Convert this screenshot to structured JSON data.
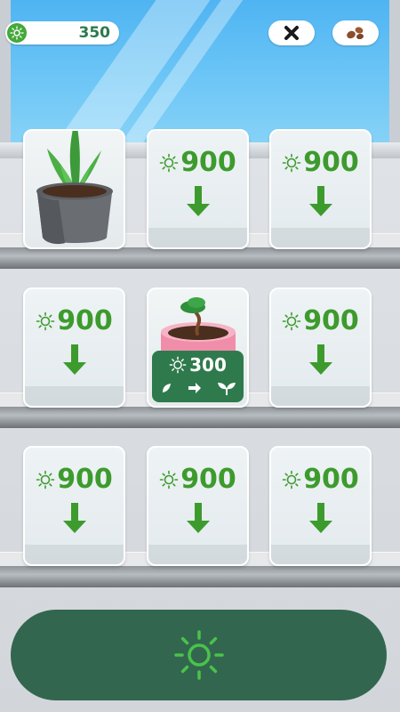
{
  "hud": {
    "sun_count": "350",
    "close_icon": "close-icon",
    "seeds_icon": "seeds-icon"
  },
  "colors": {
    "price_green": "#3d9b2d",
    "panel_green": "#2f7a4d",
    "button_green": "#33664f",
    "sky_blue": "#5dbdf4"
  },
  "shelves": {
    "row1": [
      {
        "state": "owned",
        "plant": "snake-plant-in-gray-pot"
      },
      {
        "state": "locked",
        "price": "900"
      },
      {
        "state": "locked",
        "price": "900"
      }
    ],
    "row2": [
      {
        "state": "locked",
        "price": "900"
      },
      {
        "state": "growing",
        "plant": "bonsai-sprout-in-pink-pot",
        "upgrade_cost": "300"
      },
      {
        "state": "locked",
        "price": "900"
      }
    ],
    "row3": [
      {
        "state": "locked",
        "price": "900"
      },
      {
        "state": "locked",
        "price": "900"
      },
      {
        "state": "locked",
        "price": "900"
      }
    ]
  },
  "main_action": {
    "icon": "sun-icon"
  }
}
